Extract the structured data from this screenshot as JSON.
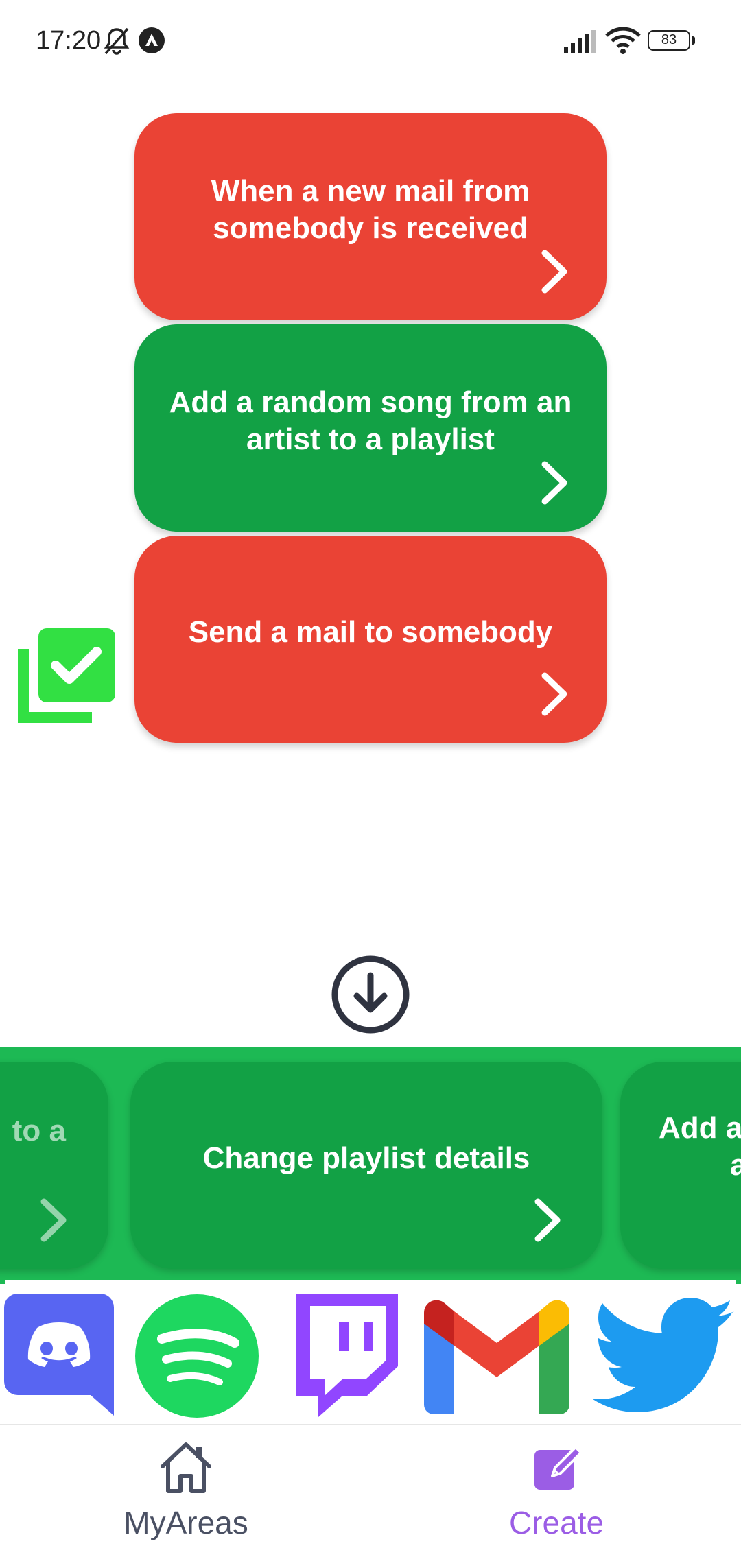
{
  "status_bar": {
    "time": "17:20",
    "battery": "83",
    "icons": [
      "bell-off-icon",
      "app-notification-icon",
      "signal-icon",
      "wifi-icon",
      "battery-icon"
    ]
  },
  "applet_chain": [
    {
      "label": "When a new mail from somebody is received",
      "color": "#ea4335"
    },
    {
      "label": "Add a random song from an artist to a playlist",
      "color": "#12a145"
    },
    {
      "label": "Send a mail to somebody",
      "color": "#ea4335"
    }
  ],
  "selected_indicator_icon": "checklist-icon",
  "add_below_icon": "arrow-down-circle-icon",
  "service_actions": {
    "background": "#1db954",
    "cards": [
      {
        "label": "to a",
        "state": "partially visible"
      },
      {
        "label": "Change playlist details"
      },
      {
        "label": "Add a",
        "label2": "a",
        "state": "partially visible"
      }
    ]
  },
  "services": [
    {
      "name": "Discord",
      "icon": "discord-icon",
      "color": "#5865f2"
    },
    {
      "name": "Spotify",
      "icon": "spotify-icon",
      "color": "#1ed760"
    },
    {
      "name": "Twitch",
      "icon": "twitch-icon",
      "color": "#9146ff"
    },
    {
      "name": "Gmail",
      "icon": "gmail-icon",
      "color": "#ea4335"
    },
    {
      "name": "Twitter",
      "icon": "twitter-icon",
      "color": "#1d9bf0"
    }
  ],
  "bottom_nav": {
    "items": [
      {
        "label": "MyAreas",
        "icon": "home-icon",
        "active": false
      },
      {
        "label": "Create",
        "icon": "edit-icon",
        "active": true
      }
    ],
    "colors": {
      "inactive": "#4a5063",
      "active": "#9b5de5"
    }
  }
}
